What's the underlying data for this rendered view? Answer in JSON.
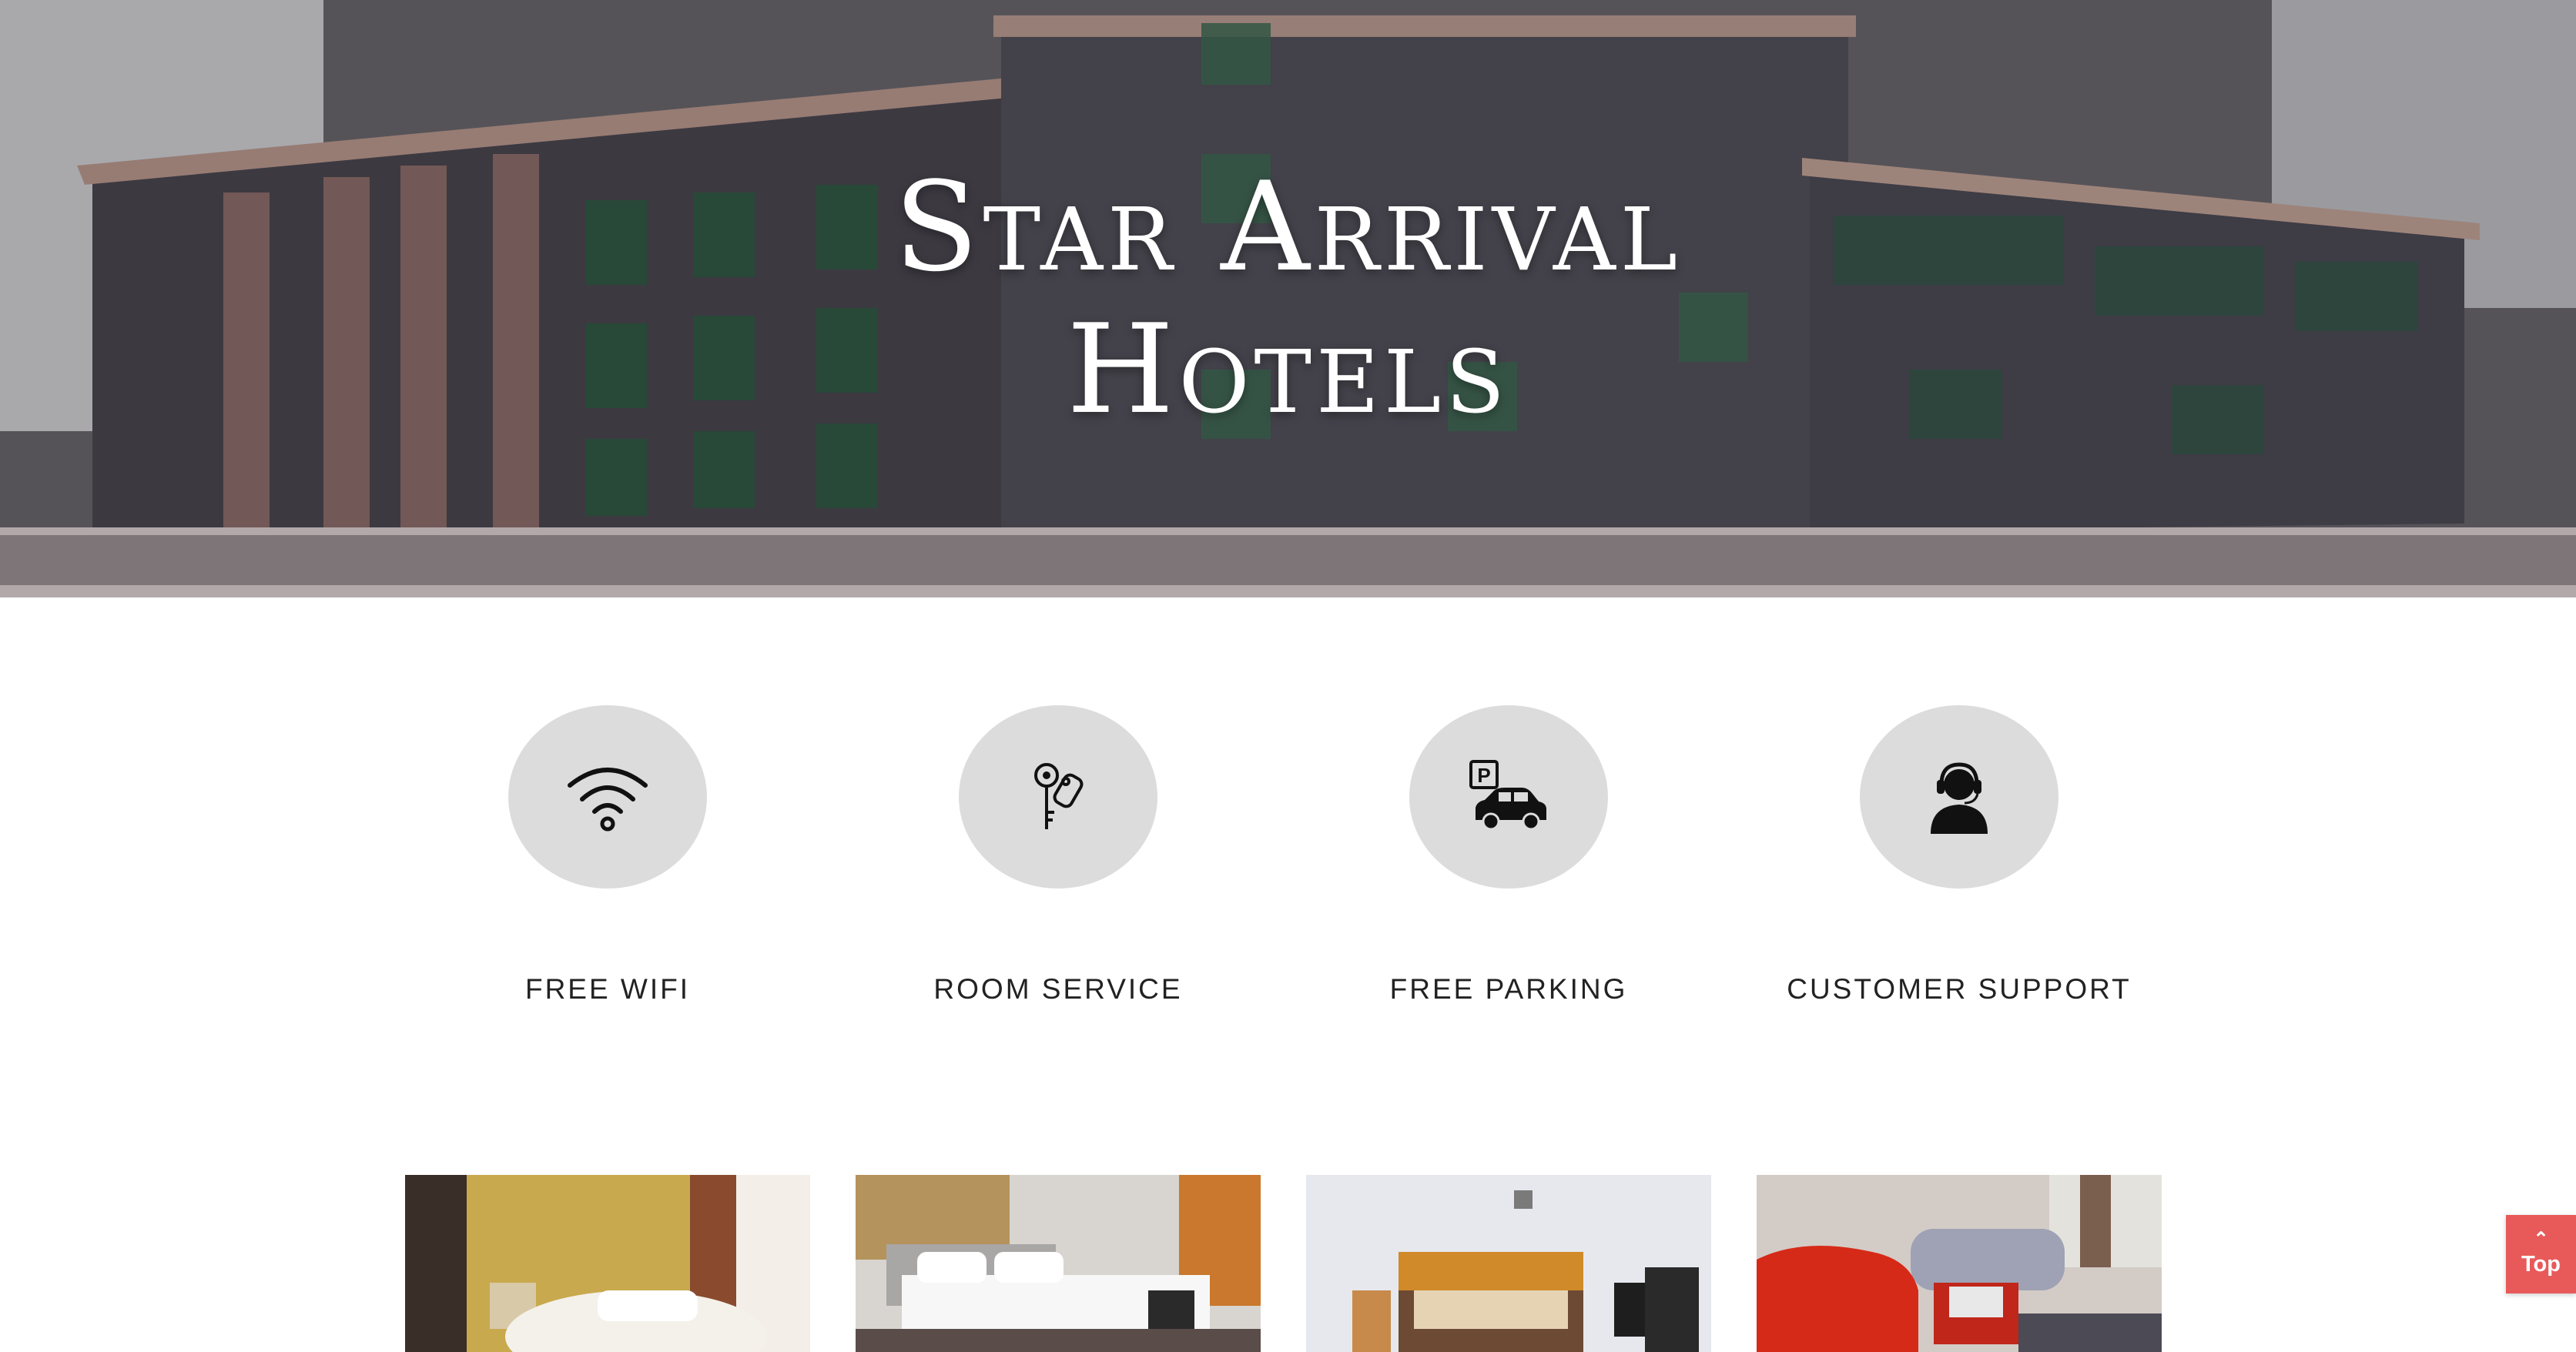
{
  "hero": {
    "title_line1": "Star Arrival",
    "title_line2": "Hotels"
  },
  "features": [
    {
      "label": "FREE WIFI",
      "icon": "wifi-icon"
    },
    {
      "label": "ROOM SERVICE",
      "icon": "keys-icon"
    },
    {
      "label": "FREE PARKING",
      "icon": "parking-car-icon"
    },
    {
      "label": "CUSTOMER SUPPORT",
      "icon": "headset-agent-icon"
    }
  ],
  "gallery": [
    {
      "name": "room-photo-1"
    },
    {
      "name": "room-photo-2"
    },
    {
      "name": "room-photo-3"
    },
    {
      "name": "lounge-photo"
    }
  ],
  "top_button": {
    "label": "Top",
    "icon": "chevron-up-icon",
    "color": "#e85a5a"
  },
  "colors": {
    "icon_circle": "#dcdcdc",
    "label_text": "#222222"
  }
}
